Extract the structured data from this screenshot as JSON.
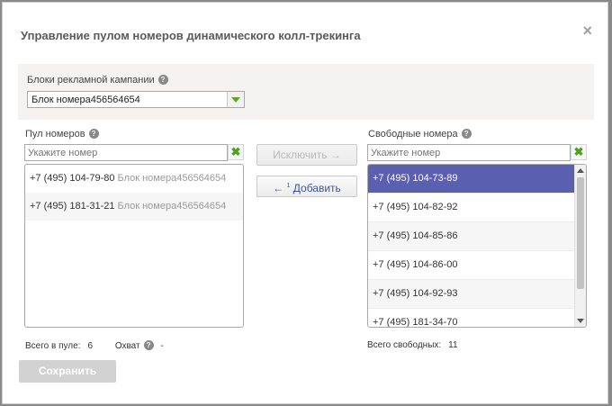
{
  "dialog": {
    "title": "Управление пулом номеров динамического колл-трекинга",
    "close_label": "×"
  },
  "campaign": {
    "label": "Блоки рекламной кампании",
    "selected_block": "Блок номера456564654"
  },
  "pool": {
    "label": "Пул номеров",
    "search_placeholder": "Укажите номер",
    "items": [
      {
        "number": "+7 (495) 104-79-80",
        "block": "Блок номера456564654"
      },
      {
        "number": "+7 (495) 181-31-21",
        "block": "Блок номера456564654"
      }
    ],
    "total_label": "Всего в пуле:",
    "total_value": "6",
    "coverage_label": "Охват",
    "coverage_value": "-"
  },
  "actions": {
    "exclude_label": "Исключить →",
    "add_label": "Добавить",
    "add_arrow": "←",
    "add_superscript": "1"
  },
  "free": {
    "label": "Свободные номера",
    "search_placeholder": "Укажите номер",
    "items": [
      "+7 (495) 104-73-89",
      "+7 (495) 104-82-92",
      "+7 (495) 104-85-86",
      "+7 (495) 104-86-00",
      "+7 (495) 104-92-93",
      "+7 (495) 181-34-70"
    ],
    "selected_index": 0,
    "total_label": "Всего свободных:",
    "total_value": "11"
  },
  "footer": {
    "save_label": "Сохранить"
  },
  "colors": {
    "selected_row": "#5a5fb0",
    "accent_green": "#5daa22",
    "link_blue": "#3b53a0"
  }
}
